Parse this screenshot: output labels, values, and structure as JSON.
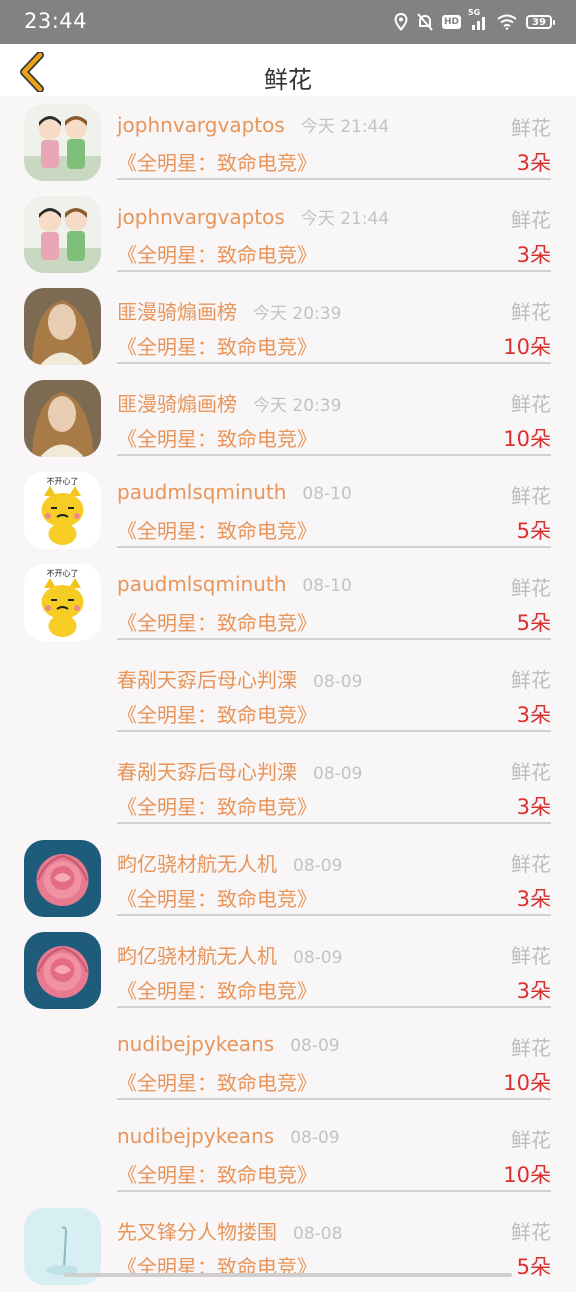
{
  "status_bar": {
    "time": "23:44",
    "hd": "HD",
    "network": "5G",
    "battery": "39"
  },
  "header": {
    "title": "鲜花",
    "back_icon": "chevron-left-icon",
    "accent": "#e6a418"
  },
  "colors": {
    "name": "#e8955a",
    "count": "#d93030",
    "muted": "#bdbdbd"
  },
  "records": [
    {
      "name": "jophnvargvaptos",
      "time": "今天 21:44",
      "type": "鲜花",
      "game": "《全明星：致命电竞》",
      "count": "3朵",
      "avatar": "anime-kids"
    },
    {
      "name": "jophnvargvaptos",
      "time": "今天 21:44",
      "type": "鲜花",
      "game": "《全明星：致命电竞》",
      "count": "3朵",
      "avatar": "anime-kids"
    },
    {
      "name": "匪漫骑煽画榜",
      "time": "今天 20:39",
      "type": "鲜花",
      "game": "《全明星：致命电竞》",
      "count": "10朵",
      "avatar": "woman-portrait"
    },
    {
      "name": "匪漫骑煽画榜",
      "time": "今天 20:39",
      "type": "鲜花",
      "game": "《全明星：致命电竞》",
      "count": "10朵",
      "avatar": "woman-portrait"
    },
    {
      "name": "paudmlsqminuth",
      "time": "08-10",
      "type": "鲜花",
      "game": "《全明星：致命电竞》",
      "count": "5朵",
      "avatar": "cartoon-cat"
    },
    {
      "name": "paudmlsqminuth",
      "time": "08-10",
      "type": "鲜花",
      "game": "《全明星：致命电竞》",
      "count": "5朵",
      "avatar": "cartoon-cat"
    },
    {
      "name": "春剐天孬后母心判溧",
      "time": "08-09",
      "type": "鲜花",
      "game": "《全明星：致命电竞》",
      "count": "3朵",
      "avatar": "none"
    },
    {
      "name": "春剐天孬后母心判溧",
      "time": "08-09",
      "type": "鲜花",
      "game": "《全明星：致命电竞》",
      "count": "3朵",
      "avatar": "none"
    },
    {
      "name": "畇亿骁材航无人机",
      "time": "08-09",
      "type": "鲜花",
      "game": "《全明星：致命电竞》",
      "count": "3朵",
      "avatar": "pink-rose"
    },
    {
      "name": "畇亿骁材航无人机",
      "time": "08-09",
      "type": "鲜花",
      "game": "《全明星：致命电竞》",
      "count": "3朵",
      "avatar": "pink-rose"
    },
    {
      "name": "nudibejpykeans",
      "time": "08-09",
      "type": "鲜花",
      "game": "《全明星：致命电竞》",
      "count": "10朵",
      "avatar": "none"
    },
    {
      "name": "nudibejpykeans",
      "time": "08-09",
      "type": "鲜花",
      "game": "《全明星：致命电竞》",
      "count": "10朵",
      "avatar": "none"
    },
    {
      "name": "先叉锋分人物搂围",
      "time": "08-08",
      "type": "鲜花",
      "game": "《全明星：致命电竞》",
      "count": "5朵",
      "avatar": "light-blue"
    }
  ],
  "avatar_text": {
    "cat_caption": "不开心了"
  }
}
